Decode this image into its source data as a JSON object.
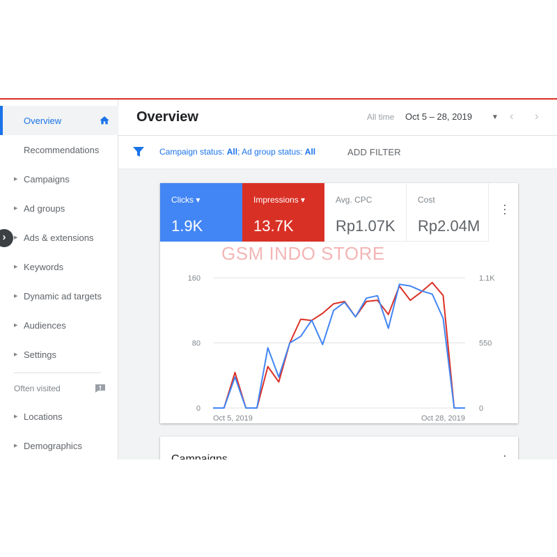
{
  "sidebar": {
    "items": [
      {
        "label": "Overview"
      },
      {
        "label": "Recommendations"
      },
      {
        "label": "Campaigns"
      },
      {
        "label": "Ad groups"
      },
      {
        "label": "Ads & extensions"
      },
      {
        "label": "Keywords"
      },
      {
        "label": "Dynamic ad targets"
      },
      {
        "label": "Audiences"
      },
      {
        "label": "Settings"
      }
    ],
    "often_visited": "Often visited",
    "extra_items": [
      {
        "label": "Locations"
      },
      {
        "label": "Demographics"
      }
    ]
  },
  "header": {
    "title": "Overview",
    "all_time": "All time",
    "date_range": "Oct 5 – 28, 2019"
  },
  "filter": {
    "campaign_status_label": "Campaign status: ",
    "campaign_status_value": "All",
    "ad_group_status_label": "; Ad group status: ",
    "ad_group_status_value": "All",
    "add_filter": "ADD FILTER"
  },
  "metrics": [
    {
      "label": "Clicks",
      "value": "1.9K",
      "color": "#4285f4"
    },
    {
      "label": "Impressions",
      "value": "13.7K",
      "color": "#d93025"
    },
    {
      "label": "Avg. CPC",
      "value": "Rp1.07K"
    },
    {
      "label": "Cost",
      "value": "Rp2.04M"
    }
  ],
  "watermark": "GSM INDO STORE",
  "chart_data": {
    "type": "line",
    "x": [
      "Oct 5",
      "Oct 6",
      "Oct 7",
      "Oct 8",
      "Oct 9",
      "Oct 10",
      "Oct 11",
      "Oct 12",
      "Oct 13",
      "Oct 14",
      "Oct 15",
      "Oct 16",
      "Oct 17",
      "Oct 18",
      "Oct 19",
      "Oct 20",
      "Oct 21",
      "Oct 22",
      "Oct 23",
      "Oct 24",
      "Oct 25",
      "Oct 26",
      "Oct 27",
      "Oct 28"
    ],
    "x_tick_labels": [
      "Oct 5, 2019",
      "Oct 28, 2019"
    ],
    "y_left_ticks": [
      "160",
      "80",
      "0"
    ],
    "y_right_ticks": [
      "1.1K",
      "550",
      "0"
    ],
    "y_left_range": [
      0,
      160
    ],
    "y_right_range": [
      0,
      1100
    ],
    "series": [
      {
        "name": "Clicks",
        "axis": "left",
        "color": "#4285f4",
        "values": [
          0,
          0,
          38,
          0,
          0,
          74,
          38,
          80,
          88,
          108,
          78,
          120,
          130,
          112,
          135,
          138,
          98,
          152,
          150,
          144,
          140,
          110,
          0,
          0
        ]
      },
      {
        "name": "Impressions",
        "axis": "right",
        "color": "#d93025",
        "values": [
          0,
          0,
          300,
          0,
          0,
          350,
          220,
          550,
          750,
          740,
          800,
          880,
          900,
          770,
          900,
          910,
          790,
          1030,
          910,
          980,
          1060,
          950,
          0,
          0
        ]
      }
    ],
    "grid": true
  },
  "campaigns_card": {
    "title": "Campaigns"
  }
}
